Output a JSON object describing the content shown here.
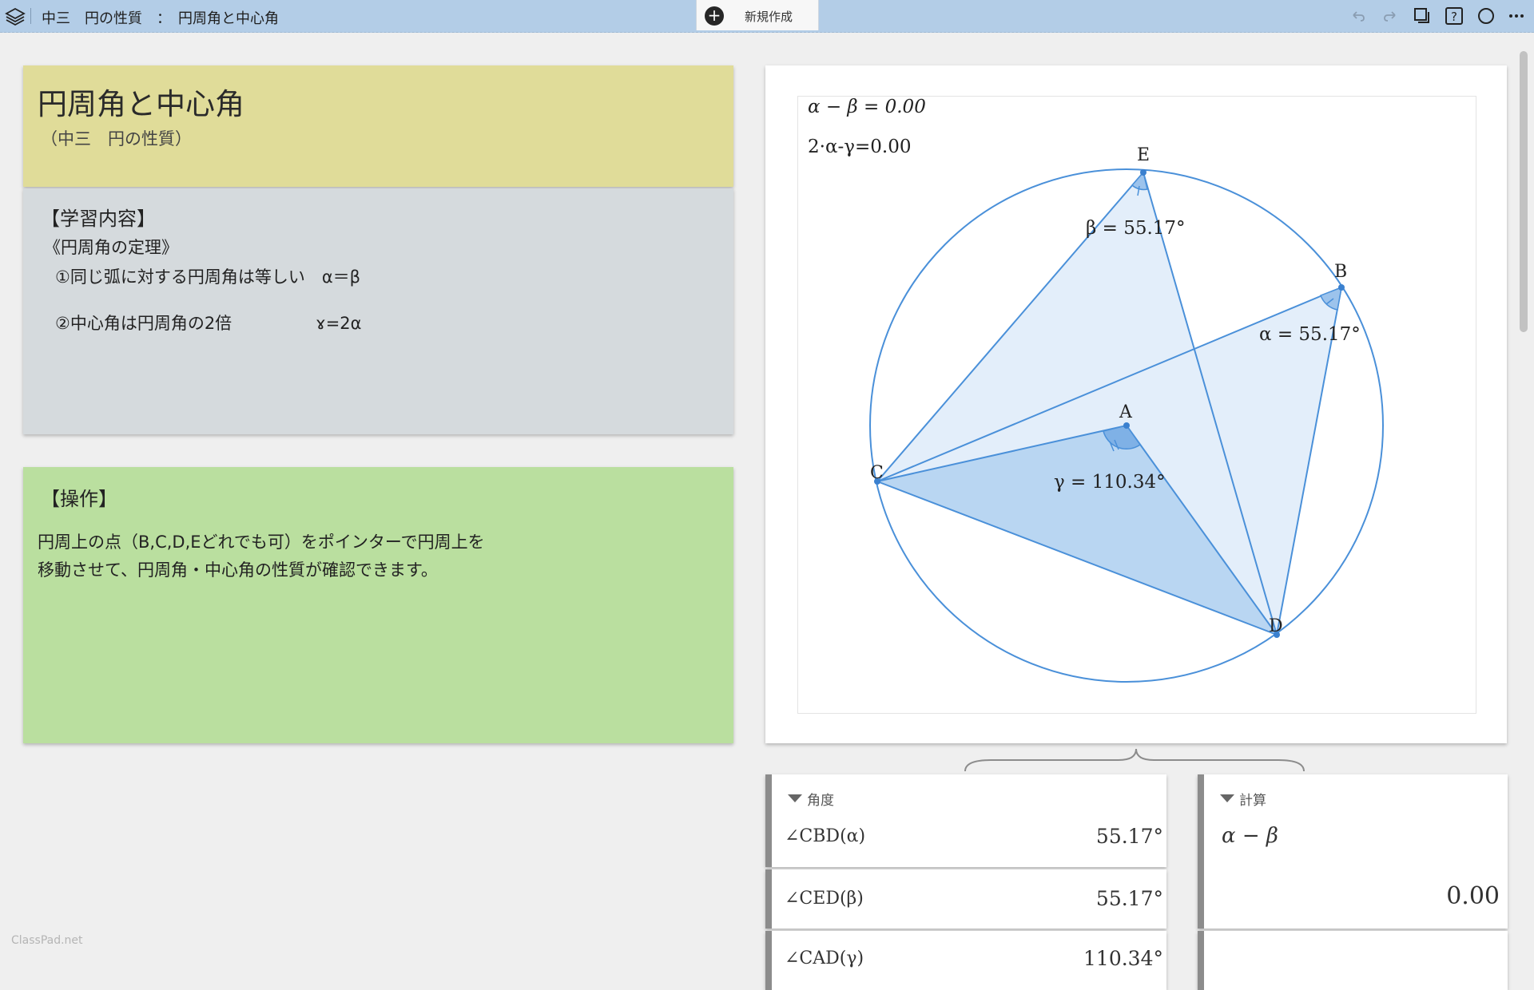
{
  "topbar": {
    "breadcrumb": "中三　円の性質　：　円周角と中心角",
    "new_tab_label": "新規作成",
    "new_tab_plus": "+"
  },
  "title_card": {
    "title": "円周角と中心角",
    "subtitle": "（中三　円の性質）"
  },
  "content_card": {
    "heading": "【学習内容】",
    "subheading": "《円周角の定理》",
    "line1": "①同じ弧に対する円周角は等しい　α＝β",
    "line2": "②中心角は円周角の2倍　　　　　ɤ=2α"
  },
  "ops_card": {
    "heading": "【操作】",
    "line1": "円周上の点（B,C,D,Eどれでも可）をポインターで円周上を",
    "line2": "移動させて、円周角・中心角の性質が確認できます。"
  },
  "graph": {
    "text1": "α − β = 0.00",
    "text2": "2·α-γ=0.00",
    "points": {
      "A": "A",
      "B": "B",
      "C": "C",
      "D": "D",
      "E": "E"
    },
    "beta_label": "β = 55.17°",
    "alpha_label": "α = 55.17°",
    "gamma_label": "γ = 110.34°",
    "colors": {
      "stroke": "#4a90d9",
      "fill_light": "#e3eefa",
      "fill_dark": "#b9d6f2"
    }
  },
  "angles_panel": {
    "header": "角度",
    "rows": [
      {
        "label": "∠CBD(α)",
        "value": "55.17°"
      },
      {
        "label": "∠CED(β)",
        "value": "55.17°"
      },
      {
        "label": "∠CAD(γ)",
        "value": "110.34°"
      }
    ]
  },
  "calc_panel": {
    "header": "計算",
    "expr": "α − β",
    "value": "0.00"
  },
  "watermark": "ClassPad.net"
}
